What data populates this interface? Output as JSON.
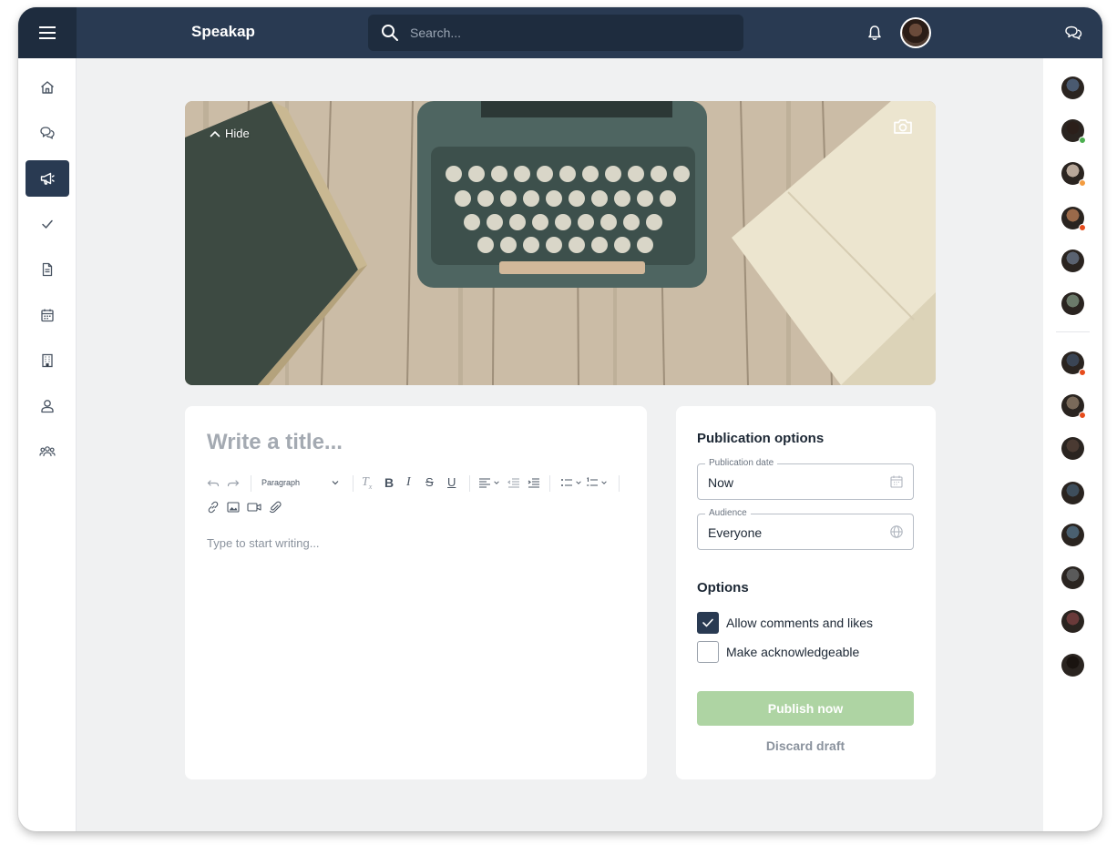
{
  "app": {
    "brand": "Speakap"
  },
  "search": {
    "placeholder": "Search..."
  },
  "sidebar": {
    "items": [
      {
        "icon": "home-icon"
      },
      {
        "icon": "chat-icon"
      },
      {
        "icon": "megaphone-icon",
        "active": true
      },
      {
        "icon": "check-icon"
      },
      {
        "icon": "document-icon"
      },
      {
        "icon": "calendar-icon"
      },
      {
        "icon": "building-icon"
      },
      {
        "icon": "user-icon"
      },
      {
        "icon": "group-icon"
      }
    ]
  },
  "contacts": {
    "avatars": [
      {
        "color": "#4a5a70",
        "status": ""
      },
      {
        "color": "#2b1f1a",
        "status": "#4caf50"
      },
      {
        "color": "#b8a89a",
        "status": "#f39c40"
      },
      {
        "color": "#9b6a4a",
        "status": "#e74c1c"
      },
      {
        "color": "#5a6270",
        "status": ""
      },
      {
        "color": "#6b7a6a",
        "status": ""
      },
      {
        "color": "#3a4555",
        "status": "#e74c1c"
      },
      {
        "color": "#7a6a5a",
        "status": "#e74c1c"
      },
      {
        "color": "#4a3a32",
        "status": ""
      },
      {
        "color": "#3e4e5c",
        "status": ""
      },
      {
        "color": "#4a6070",
        "status": ""
      },
      {
        "color": "#5a5a5a",
        "status": ""
      },
      {
        "color": "#6a3a3a",
        "status": ""
      },
      {
        "color": "#1a1410",
        "status": ""
      }
    ]
  },
  "hero": {
    "hide_label": "Hide"
  },
  "editor": {
    "title_placeholder": "Write a title...",
    "paragraph_select": "Paragraph",
    "body_placeholder": "Type to start writing..."
  },
  "publication": {
    "title": "Publication options",
    "date_label": "Publication date",
    "date_value": "Now",
    "audience_label": "Audience",
    "audience_value": "Everyone",
    "options_title": "Options",
    "allow_comments_label": "Allow comments and likes",
    "allow_comments_checked": true,
    "acknowledge_label": "Make acknowledgeable",
    "acknowledge_checked": false,
    "publish_label": "Publish now",
    "discard_label": "Discard draft"
  },
  "colors": {
    "nav": "#293a52",
    "nav_dark": "#1e2c3e",
    "publish_disabled": "#aed4a3",
    "background": "#f0f1f2"
  }
}
